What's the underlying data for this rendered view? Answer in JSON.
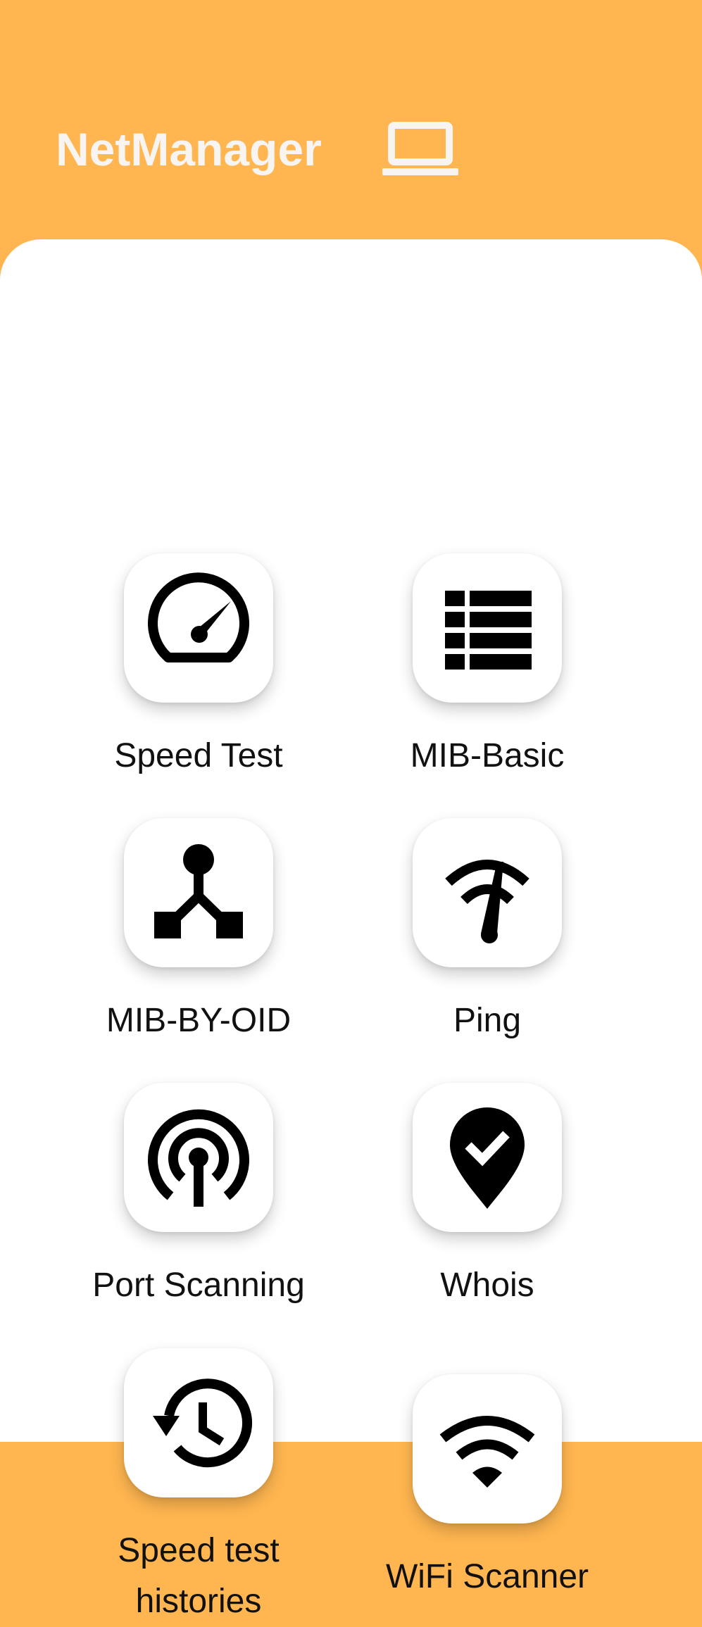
{
  "header": {
    "title": "NetManager",
    "icon": "laptop-icon",
    "background": "#FFB650",
    "title_color": "#F7F4F2"
  },
  "tools": [
    {
      "label": "Speed Test",
      "icon": "speedometer-icon"
    },
    {
      "label": "MIB-Basic",
      "icon": "list-icon"
    },
    {
      "label": "MIB-BY-OID",
      "icon": "tree-icon"
    },
    {
      "label": "Ping",
      "icon": "signal-gauge-icon"
    },
    {
      "label": "Port Scanning",
      "icon": "broadcast-icon"
    },
    {
      "label": "Whois",
      "icon": "location-check-icon"
    },
    {
      "label": "Speed test histories",
      "icon": "history-icon"
    },
    {
      "label": "WiFi Scanner",
      "icon": "wifi-icon"
    }
  ]
}
